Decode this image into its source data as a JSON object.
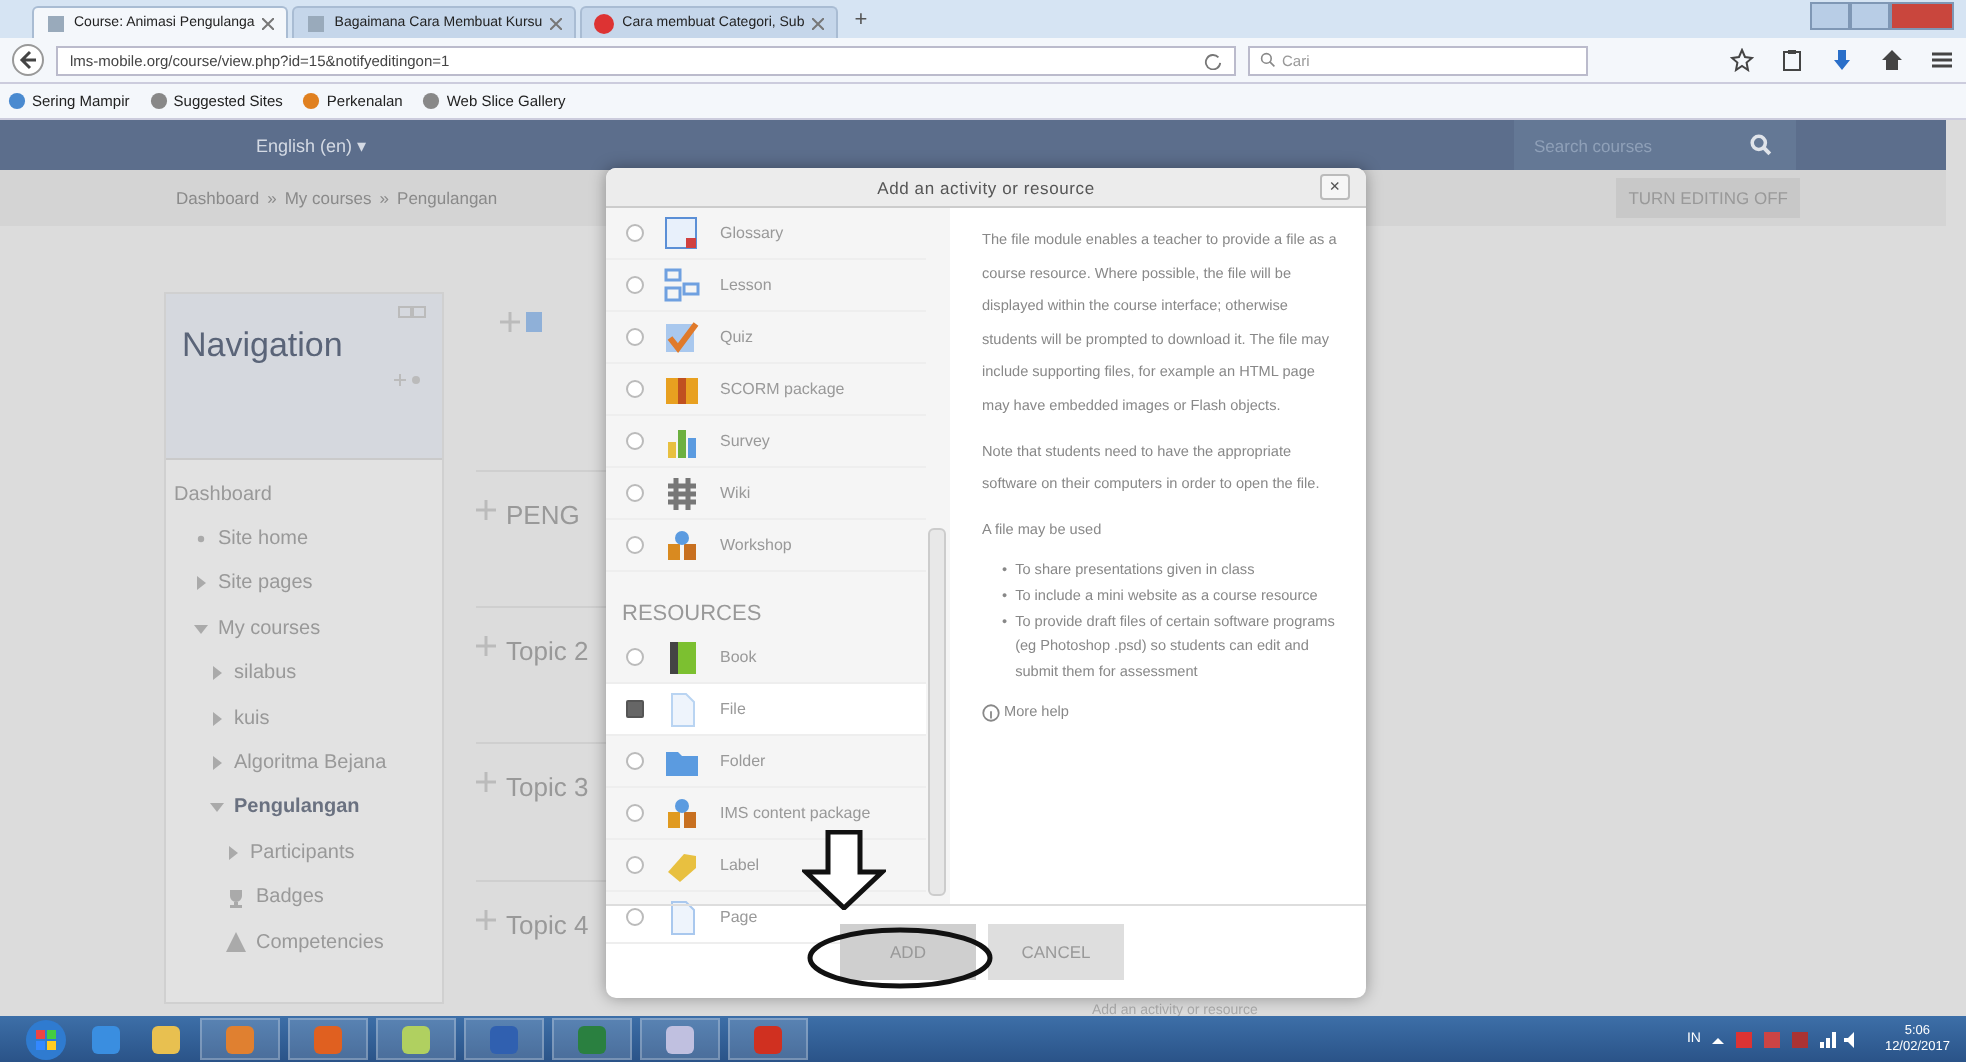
{
  "browser": {
    "tabs": [
      {
        "title": "Course: Animasi Pengulanga",
        "selected": true
      },
      {
        "title": "Bagaimana Cara Membuat Kursu",
        "selected": false
      },
      {
        "title": "Cara membuat Categori, Sub",
        "selected": false
      }
    ],
    "new_tab": "+",
    "url": "lms-mobile.org/course/view.php?id=15&notifyeditingon=1",
    "search_placeholder": "Cari",
    "bookmarks": [
      "Sering Mampir",
      "Suggested Sites",
      "Perkenalan",
      "Web Slice Gallery"
    ]
  },
  "header": {
    "language": "English (en) ▾",
    "search_placeholder": "Search courses"
  },
  "breadcrumb": {
    "items": [
      "Dashboard",
      "My courses",
      "Pengulangan"
    ],
    "separator": "»"
  },
  "edit_button": "TURN EDITING OFF",
  "navigation": {
    "title": "Navigation",
    "items": [
      {
        "label": "Dashboard",
        "kind": "root",
        "current": false,
        "children": [
          {
            "label": "Site home",
            "kind": "bullet",
            "current": false
          },
          {
            "label": "Site pages",
            "kind": "branch",
            "current": false,
            "expanded": false
          },
          {
            "label": "My courses",
            "kind": "branch",
            "current": false,
            "expanded": true,
            "children": [
              {
                "label": "silabus",
                "kind": "branch",
                "current": false,
                "expanded": false
              },
              {
                "label": "kuis",
                "kind": "branch",
                "current": false,
                "expanded": false
              },
              {
                "label": "Algoritma Bejana",
                "kind": "branch",
                "current": false,
                "expanded": false
              },
              {
                "label": "Pengulangan",
                "kind": "branch",
                "current": true,
                "expanded": true,
                "children": [
                  {
                    "label": "Participants",
                    "kind": "branch",
                    "current": false,
                    "expanded": false
                  },
                  {
                    "label": "Badges",
                    "kind": "badges",
                    "current": false
                  },
                  {
                    "label": "Competencies",
                    "kind": "competencies",
                    "current": false
                  }
                ]
              }
            ]
          }
        ]
      }
    ]
  },
  "sections": [
    "PENG",
    "Topic 2",
    "Topic 3",
    "Topic 4"
  ],
  "behind_link": "Add an activity or resource",
  "modal": {
    "title": "Add an activity or resource",
    "close": "×",
    "activities": [
      {
        "name": "Glossary",
        "kind": "glossary",
        "selected": false
      },
      {
        "name": "Lesson",
        "kind": "lesson",
        "selected": false
      },
      {
        "name": "Quiz",
        "kind": "quiz",
        "selected": false
      },
      {
        "name": "SCORM package",
        "kind": "scorm",
        "selected": false
      },
      {
        "name": "Survey",
        "kind": "survey",
        "selected": false
      },
      {
        "name": "Wiki",
        "kind": "wiki",
        "selected": false
      },
      {
        "name": "Workshop",
        "kind": "workshop",
        "selected": false
      }
    ],
    "resources_heading": "RESOURCES",
    "resources": [
      {
        "name": "Book",
        "kind": "book",
        "selected": false
      },
      {
        "name": "File",
        "kind": "file",
        "selected": true
      },
      {
        "name": "Folder",
        "kind": "folder",
        "selected": false
      },
      {
        "name": "IMS content package",
        "kind": "ims",
        "selected": false
      },
      {
        "name": "Label",
        "kind": "label",
        "selected": false
      },
      {
        "name": "Page",
        "kind": "page",
        "selected": false
      }
    ],
    "description": [
      "The file module enables a teacher to provide a file as a course resource. Where possible, the file will be displayed within the course interface; otherwise students will be prompted to download it. The file may include supporting files, for example an HTML page may have embedded images or Flash objects.",
      "Note that students need to have the appropriate software on their computers in order to open the file.",
      "A file may be used"
    ],
    "uses_bullet": "•",
    "uses": [
      "To share presentations given in class",
      "To include a mini website as a course resource",
      "To provide draft files of certain software programs (eg Photoshop .psd) so students can edit and submit them for assessment"
    ],
    "more_help": "More help",
    "add_button": "ADD",
    "cancel_button": "CANCEL"
  },
  "taskbar": {
    "language": "IN",
    "time": "5:06",
    "date": "12/02/2017"
  }
}
